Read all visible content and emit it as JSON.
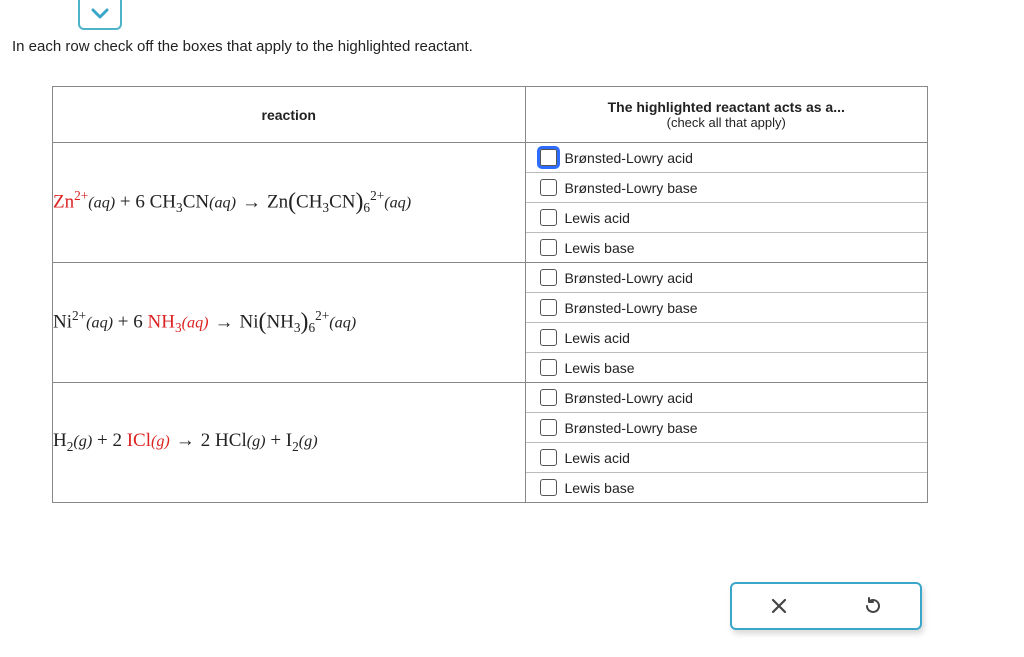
{
  "instruction": "In each row check off the boxes that apply to the highlighted reactant.",
  "headers": {
    "reaction": "reaction",
    "acts_as": "The highlighted reactant acts as a...",
    "acts_as_sub": "(check all that apply)"
  },
  "options": [
    "Brønsted-Lowry acid",
    "Brønsted-Lowry base",
    "Lewis acid",
    "Lewis base"
  ],
  "rows": [
    {
      "reaction_parts": {
        "r1_species": "Zn",
        "r1_charge": "2+",
        "r1_state": "(aq)",
        "plus": " + ",
        "coef2": "6",
        "r2_formula_pre": " CH",
        "r2_sub1": "3",
        "r2_formula_post": "CN",
        "r2_state": "(aq)",
        "arrow": "→",
        "p_species": "Zn",
        "p_lig_pre": "CH",
        "p_lig_sub": "3",
        "p_lig_post": "CN",
        "p_subn": "6",
        "p_charge": "2+",
        "p_state": "(aq)"
      },
      "highlighted_index": 0
    },
    {
      "reaction_parts": {
        "r1_species": "Ni",
        "r1_charge": "2+",
        "r1_state": "(aq)",
        "plus": " + ",
        "coef2": "6",
        "r2_formula_pre": " NH",
        "r2_sub1": "3",
        "r2_formula_post": "",
        "r2_state": "(aq)",
        "arrow": "→",
        "p_species": "Ni",
        "p_lig_pre": "NH",
        "p_lig_sub": "3",
        "p_lig_post": "",
        "p_subn": "6",
        "p_charge": "2+",
        "p_state": "(aq)"
      },
      "highlighted_index": 1
    },
    {
      "reaction_parts": {
        "r1_species": "H",
        "r1_sub": "2",
        "r1_state": "(g)",
        "plus": " + ",
        "coef2": "2",
        "r2_formula_pre": " ICl",
        "r2_state": "(g)",
        "arrow": "→",
        "p1_coef": "2",
        "p1_formula": " HCl",
        "p1_state": "(g)",
        "plus2": " + ",
        "p2_species": "I",
        "p2_sub": "2",
        "p2_state": "(g)"
      },
      "highlighted_index": 1
    }
  ],
  "icons": {
    "chevron": "chevron-down-icon",
    "close": "close-icon",
    "reset": "reset-icon"
  }
}
